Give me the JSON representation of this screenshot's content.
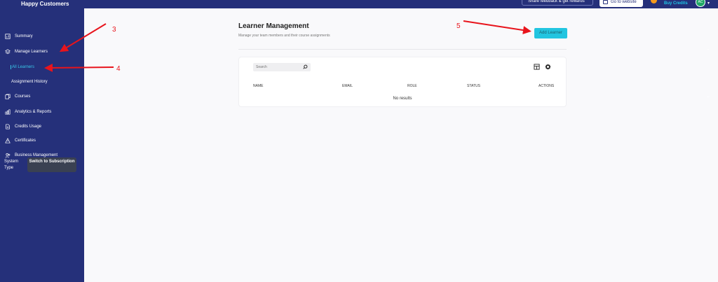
{
  "topbar": {
    "brand": "Happy Customers",
    "feedback_label": "Share feedback & get rewards",
    "website_label": "Go to website",
    "credits_label": "Buy Credits",
    "avatar_initials": "AC"
  },
  "sidebar": {
    "items": [
      {
        "label": "Summary",
        "icon": "chart-icon"
      },
      {
        "label": "Manage Learners",
        "icon": "layers-icon"
      },
      {
        "label": "All Learners"
      },
      {
        "label": "Assignment History"
      },
      {
        "label": "Courses",
        "icon": "courses-icon"
      },
      {
        "label": "Analytics & Reports",
        "icon": "analytics-icon"
      },
      {
        "label": "Credits Usage",
        "icon": "document-icon"
      },
      {
        "label": "Certificates",
        "icon": "certificate-icon"
      },
      {
        "label": "Business Management",
        "icon": "users-icon"
      }
    ],
    "system_type_label": "System Type",
    "switch_label": "Switch to Subscription"
  },
  "main": {
    "title": "Learner Management",
    "subtitle": "Manage your team members and their course assignments",
    "add_button": "Add Learner",
    "search_placeholder": "Search",
    "columns": [
      "NAME",
      "EMAIL",
      "ROLE",
      "STATUS",
      "ACTIONS"
    ],
    "empty_text": "No results"
  },
  "annotations": [
    "3",
    "4",
    "5"
  ],
  "colors": {
    "sidebar": "#25307a",
    "active": "#38c6e8",
    "accent": "#22c5e0",
    "annotation": "#e8141c"
  }
}
